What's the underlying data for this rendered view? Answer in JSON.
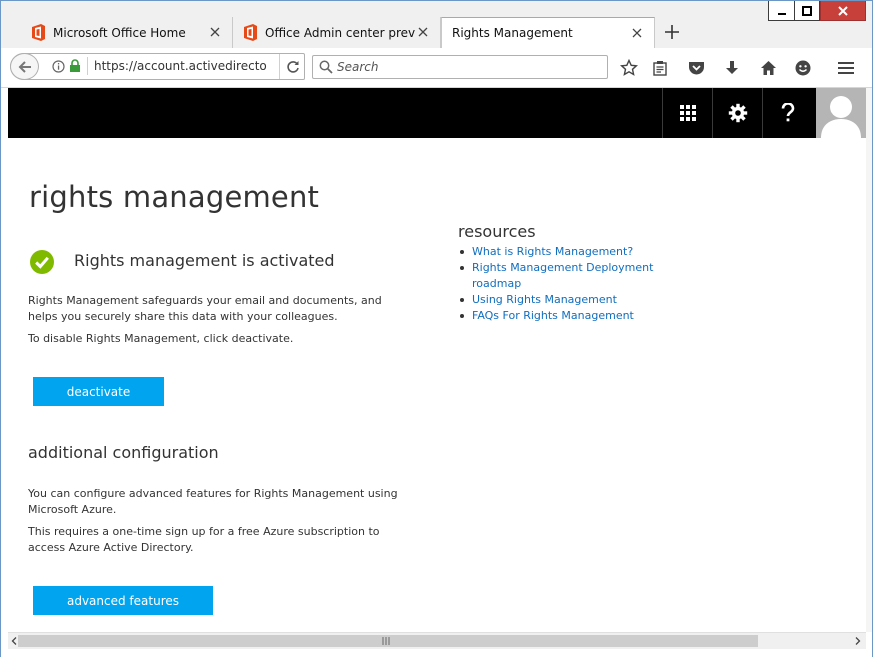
{
  "browser": {
    "tabs": [
      {
        "title": "Microsoft Office Home",
        "active": false,
        "icon": "office-logo-icon"
      },
      {
        "title": "Office Admin center previ",
        "active": false,
        "icon": "office-logo-icon"
      },
      {
        "title": "Rights Management",
        "active": true,
        "icon": ""
      }
    ],
    "url": "https://account.activedirecto",
    "search_placeholder": "Search"
  },
  "app": {
    "header_buttons": [
      "app-launcher-icon",
      "gear-icon",
      "help-icon"
    ],
    "accent_color": "#00a4ef"
  },
  "page": {
    "title": "rights management",
    "status": "Rights management is activated",
    "description": "Rights Management safeguards your email and documents, and helps you securely share this data with your colleagues.",
    "disable_hint": "To disable Rights Management, click deactivate.",
    "deactivate_label": "deactivate",
    "config_heading": "additional configuration",
    "config_text": "You can configure advanced features for Rights Management using Microsoft Azure.",
    "signup_text": "This requires a one-time sign up for a free Azure subscription to access Azure Active Directory.",
    "advanced_label": "advanced features",
    "resources_heading": "resources",
    "resources": [
      "What is Rights Management?",
      "Rights Management Deployment roadmap",
      "Using Rights Management",
      "FAQs For Rights Management"
    ]
  }
}
